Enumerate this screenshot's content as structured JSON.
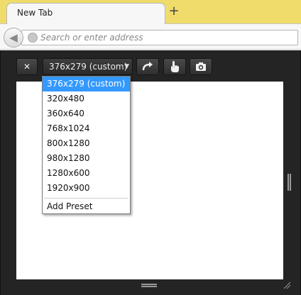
{
  "browser": {
    "tab_title": "New Tab",
    "new_tab_glyph": "+",
    "back_glyph": "◀",
    "url_placeholder": "Search or enter address"
  },
  "responsive_toolbar": {
    "close_glyph": "✕",
    "preset_selected": "376x279 (custom)",
    "preset_arrow": "▼",
    "rotate_icon": "rotate-icon",
    "touch_icon": "touch-icon",
    "screenshot_icon": "camera-icon"
  },
  "preset_dropdown": {
    "options": [
      "376x279 (custom)",
      "320x480",
      "360x640",
      "768x1024",
      "800x1280",
      "980x1280",
      "1280x600",
      "1920x900"
    ],
    "selected_index": 0,
    "add_preset_label": "Add Preset"
  },
  "colors": {
    "tabstrip": "#f0dc6b",
    "viewport_background": "#242424",
    "selection": "#3399ff"
  }
}
